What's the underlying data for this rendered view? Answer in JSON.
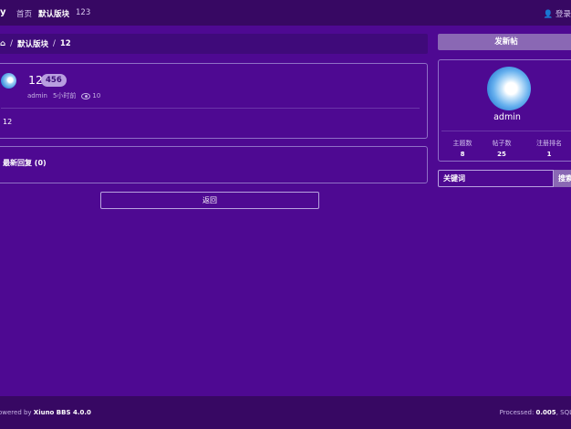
{
  "header": {
    "brand": "y",
    "nav": [
      "首页",
      "默认版块",
      "123"
    ],
    "user_link": "登录"
  },
  "breadcrumb": {
    "current_forum": "默认版块",
    "current_thread": "12"
  },
  "thread": {
    "title": "12",
    "views_badge": "456",
    "author": "admin",
    "time": "5小时前",
    "views": "10",
    "body": "12"
  },
  "replies": {
    "label": "最新回复 (0)"
  },
  "back_label": "返回",
  "sidebar": {
    "post_button": "发新帖",
    "username": "admin",
    "stats": [
      {
        "label": "主题数",
        "value": "8"
      },
      {
        "label": "帖子数",
        "value": "25"
      },
      {
        "label": "注册排名",
        "value": "1"
      }
    ],
    "search_placeholder": "关键词",
    "search_button": "搜索"
  },
  "footer": {
    "powered_prefix": "Powered by ",
    "powered_name": "Xiuno BBS 4.0.0",
    "processed_prefix": "Processed: ",
    "processed_value": "0.005",
    "sql_label": ", SQL"
  },
  "colors": {
    "background": "#4e0992",
    "bar": "#370863",
    "accent": "#8a68b4",
    "badge": "#b89ee0"
  }
}
